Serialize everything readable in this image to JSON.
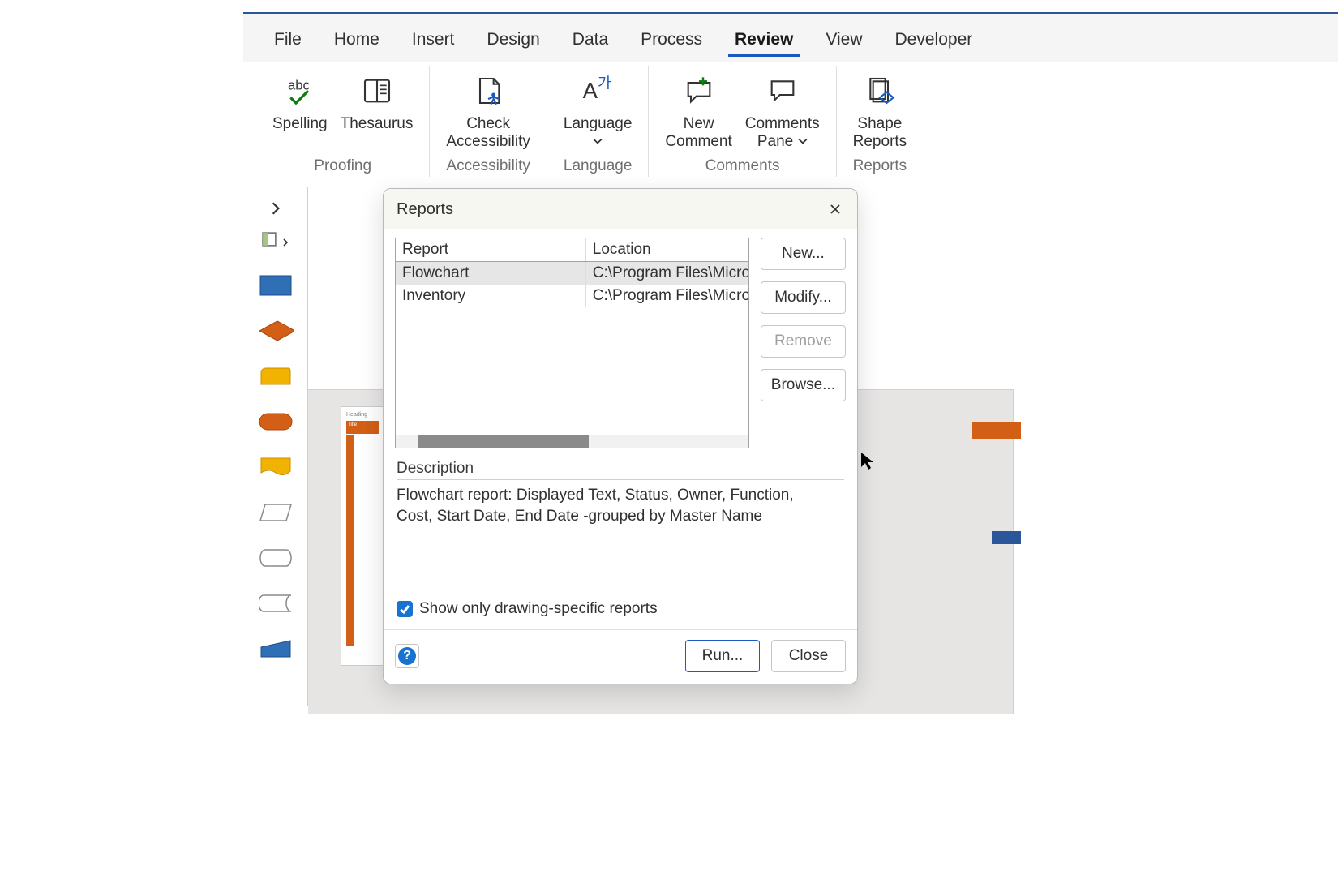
{
  "ribbon": {
    "tabs": [
      "File",
      "Home",
      "Insert",
      "Design",
      "Data",
      "Process",
      "Review",
      "View",
      "Developer"
    ],
    "active_tab": "Review",
    "groups": {
      "proofing": {
        "label": "Proofing",
        "spelling": "Spelling",
        "thesaurus": "Thesaurus"
      },
      "accessibility": {
        "label": "Accessibility",
        "check": "Check\nAccessibility"
      },
      "language": {
        "label": "Language",
        "btn": "Language"
      },
      "comments": {
        "label": "Comments",
        "new_comment": "New\nComment",
        "comments_pane": "Comments\nPane"
      },
      "reports": {
        "label": "Reports",
        "shape_reports": "Shape\nReports"
      }
    }
  },
  "dialog": {
    "title": "Reports",
    "columns": {
      "report": "Report",
      "location": "Location"
    },
    "rows": [
      {
        "report": "Flowchart",
        "location": "C:\\Program Files\\Microsoft",
        "selected": true
      },
      {
        "report": "Inventory",
        "location": "C:\\Program Files\\Microsoft",
        "selected": false
      }
    ],
    "buttons": {
      "new": "New...",
      "modify": "Modify...",
      "remove": "Remove",
      "browse": "Browse..."
    },
    "description_label": "Description",
    "description_text": "Flowchart report: Displayed Text, Status, Owner, Function, Cost, Start Date, End Date -grouped by Master Name",
    "checkbox_label": "Show only drawing-specific reports",
    "checkbox_checked": true,
    "footer": {
      "run": "Run...",
      "close": "Close"
    }
  },
  "canvas": {
    "heading": "Heading",
    "title": "Title"
  }
}
